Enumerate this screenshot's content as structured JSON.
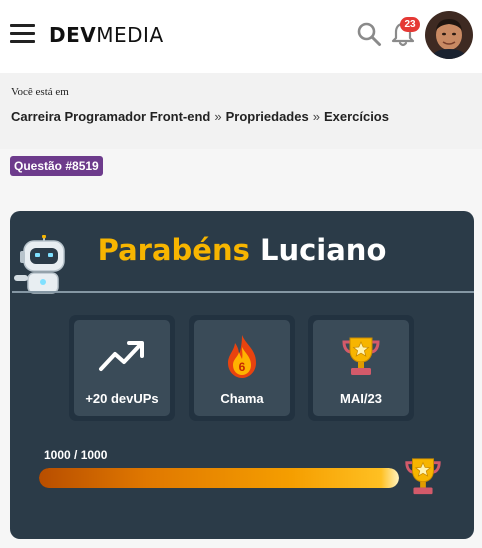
{
  "header": {
    "logo_bold": "DEV",
    "logo_light": "MEDIA",
    "notification_count": "23",
    "icons": [
      "menu-icon",
      "search-icon",
      "bell-icon",
      "avatar"
    ]
  },
  "breadcrumb": {
    "label": "Você está em",
    "items": [
      "Carreira Programador Front-end",
      "Propriedades",
      "Exercícios"
    ],
    "separator": "»"
  },
  "question": {
    "badge": "Questão #8519"
  },
  "card": {
    "greeting": "Parabéns",
    "name": "Luciano",
    "stats": [
      {
        "icon": "trending-up-icon",
        "label": "+20 devUPs"
      },
      {
        "icon": "flame-icon",
        "value": "6",
        "label": "Chama"
      },
      {
        "icon": "trophy-icon",
        "label": "MAI/23"
      }
    ],
    "progress": {
      "text": "1000 / 1000",
      "current": 1000,
      "max": 1000
    }
  },
  "colors": {
    "card_bg": "#2b3b48",
    "accent": "#f7b500",
    "badge": "#6d3b8c",
    "notification": "#e53935"
  }
}
